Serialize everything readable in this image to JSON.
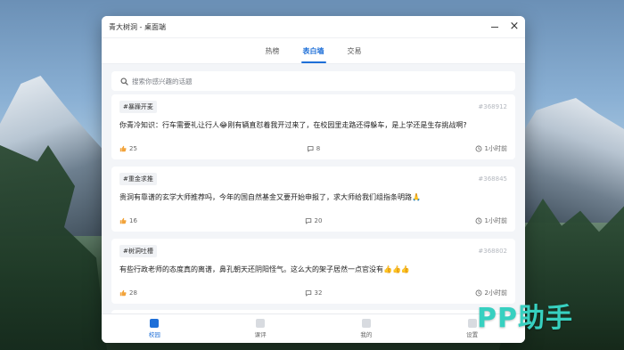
{
  "window": {
    "title": "青大树洞 - 桌面端"
  },
  "tabs": [
    {
      "label": "热榜",
      "active": false
    },
    {
      "label": "表白墙",
      "active": true
    },
    {
      "label": "交易",
      "active": false
    }
  ],
  "search": {
    "placeholder": "搜索你感兴趣的话题"
  },
  "posts": [
    {
      "tag": "#暴躁开麦",
      "id": "#368912",
      "content": "你青冷知识：行车需要礼让行人😂刚有辆直怼着我开过来了，在校园里走路还得躲车，是上学还是生存挑战啊?",
      "likes": "25",
      "comments": "8",
      "time": "1小时前"
    },
    {
      "tag": "#重金求推",
      "id": "#368845",
      "content": "贵洞有靠谱的玄学大师推荐吗，今年的国自然基金又要开始申报了，求大师给我们组指条明路🙏",
      "likes": "16",
      "comments": "20",
      "time": "1小时前"
    },
    {
      "tag": "#树洞吐槽",
      "id": "#368802",
      "content": "有些行政老师的态度真的离谱，鼻孔朝天还阴阳怪气。这么大的架子居然一点官没有👍👍👍",
      "likes": "28",
      "comments": "32",
      "time": "2小时前"
    }
  ],
  "bottom_nav": [
    {
      "label": "校园",
      "active": true
    },
    {
      "label": "课评",
      "active": false
    },
    {
      "label": "我的",
      "active": false
    },
    {
      "label": "设置",
      "active": false
    }
  ],
  "watermark": "PP助手",
  "colors": {
    "accent": "#1e6fd8",
    "watermark": "#37d0c0"
  }
}
